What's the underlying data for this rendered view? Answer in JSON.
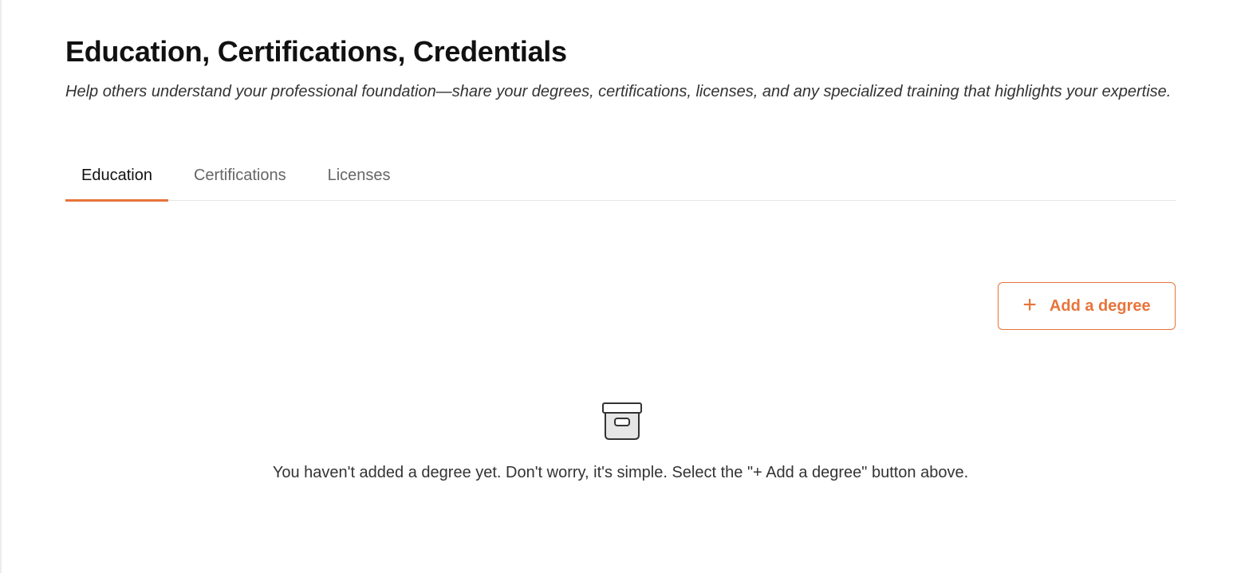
{
  "header": {
    "title": "Education, Certifications, Credentials",
    "subtitle": "Help others understand your professional foundation—share your degrees, certifications, licenses, and any specialized training that highlights your expertise."
  },
  "tabs": [
    {
      "label": "Education",
      "active": true
    },
    {
      "label": "Certifications",
      "active": false
    },
    {
      "label": "Licenses",
      "active": false
    }
  ],
  "actions": {
    "add_label": "Add a degree",
    "add_icon": "plus-icon"
  },
  "empty_state": {
    "icon": "archive-box-icon",
    "message": "You haven't added a degree yet. Don't worry, it's simple. Select the \"+ Add a degree\" button above."
  },
  "colors": {
    "accent": "#e8743a",
    "text_primary": "#111111",
    "text_secondary": "#666666"
  }
}
